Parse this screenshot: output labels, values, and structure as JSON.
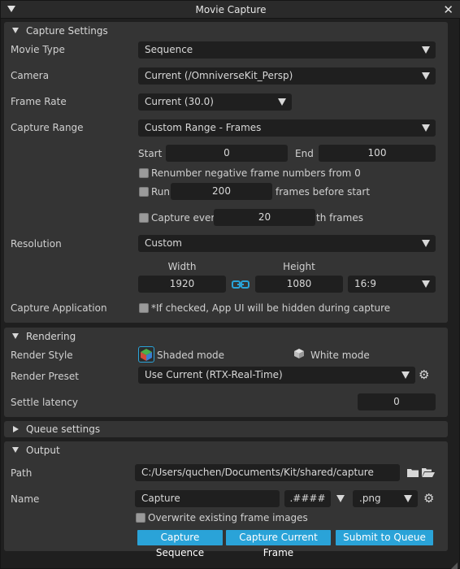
{
  "window": {
    "title": "Movie Capture"
  },
  "capture_settings": {
    "header": "Capture Settings",
    "movie_type": {
      "label": "Movie Type",
      "value": "Sequence"
    },
    "camera": {
      "label": "Camera",
      "value": "Current (/OmniverseKit_Persp)"
    },
    "frame_rate": {
      "label": "Frame Rate",
      "value": "Current (30.0)"
    },
    "capture_range": {
      "label": "Capture Range",
      "value": "Custom Range - Frames"
    },
    "start": {
      "label": "Start",
      "value": "0"
    },
    "end": {
      "label": "End",
      "value": "100"
    },
    "renumber": {
      "label": "Renumber negative frame numbers from 0",
      "checked": false
    },
    "run": {
      "label": "Run",
      "value": "200",
      "suffix": "frames before start",
      "checked": false
    },
    "capture_every": {
      "label": "Capture every",
      "value": "20",
      "suffix": "th frames",
      "checked": false
    },
    "resolution": {
      "label": "Resolution",
      "value": "Custom"
    },
    "width": {
      "label": "Width",
      "value": "1920"
    },
    "height": {
      "label": "Height",
      "value": "1080"
    },
    "aspect": {
      "value": "16:9"
    },
    "capture_application": {
      "label": "Capture Application",
      "note": "*If checked, App UI will be hidden during capture",
      "checked": false
    }
  },
  "rendering": {
    "header": "Rendering",
    "render_style": {
      "label": "Render Style",
      "shaded": "Shaded mode",
      "white": "White mode"
    },
    "render_preset": {
      "label": "Render Preset",
      "value": "Use Current (RTX-Real-Time)"
    },
    "settle_latency": {
      "label": "Settle latency",
      "value": "0"
    }
  },
  "queue": {
    "header": "Queue settings"
  },
  "output": {
    "header": "Output",
    "path": {
      "label": "Path",
      "value": "C:/Users/quchen/Documents/Kit/shared/capture"
    },
    "name": {
      "label": "Name",
      "value": "Capture",
      "pattern": ".####",
      "ext": ".png"
    },
    "overwrite": {
      "label": "Overwrite existing frame images",
      "checked": false
    },
    "buttons": {
      "capture_sequence": "Capture Sequence",
      "capture_current_frame": "Capture Current Frame",
      "submit_to_queue": "Submit to Queue"
    }
  },
  "colors": {
    "accent": "#2aa3d8",
    "panel": "#343434",
    "field": "#1f1f1f",
    "background": "#1f1f1f"
  }
}
